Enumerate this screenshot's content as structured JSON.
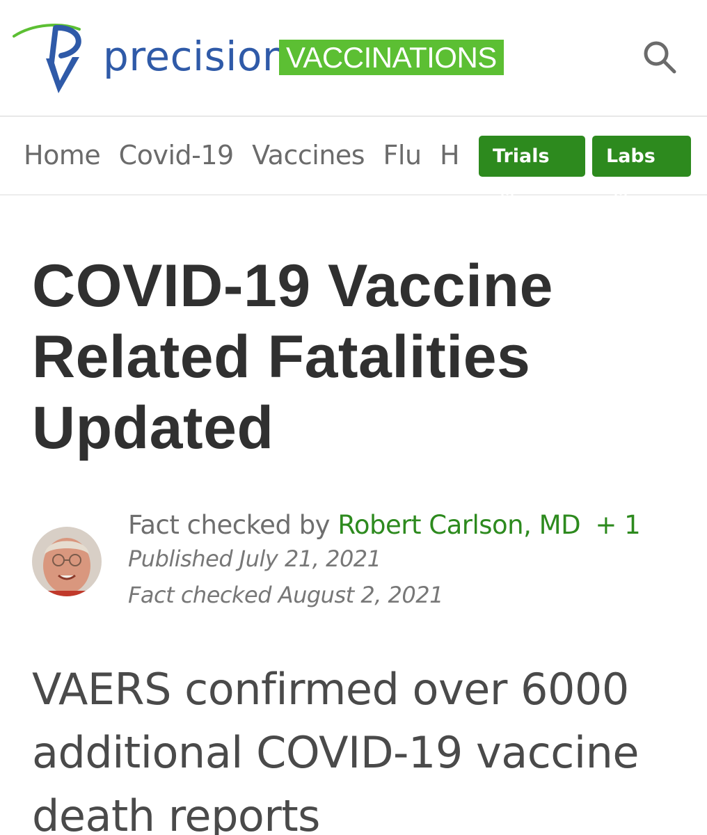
{
  "brand": {
    "wordmark": "precision",
    "badge": "VACCINATIONS",
    "colors": {
      "blue": "#2f5aa8",
      "green_badge": "#5cbf33",
      "green_button": "#2d8a1e"
    }
  },
  "header": {
    "search_icon": "search-icon"
  },
  "nav": {
    "links": [
      "Home",
      "Covid-19",
      "Vaccines",
      "Flu",
      "Hep"
    ],
    "buttons": {
      "trials": "Trials",
      "labs": "Labs"
    },
    "button_icon": "external-link-icon"
  },
  "article": {
    "title": "COVID-19 Vaccine Related Fatalities Updated",
    "fact_check_prefix": "Fact checked by",
    "author": "Robert Carlson, MD",
    "author_extra": "+ 1",
    "published": "Published July 21, 2021",
    "fact_checked": "Fact checked August 2, 2021",
    "subtitle": "VAERS confirmed over 6000 additional COVID-19 vaccine death reports"
  }
}
